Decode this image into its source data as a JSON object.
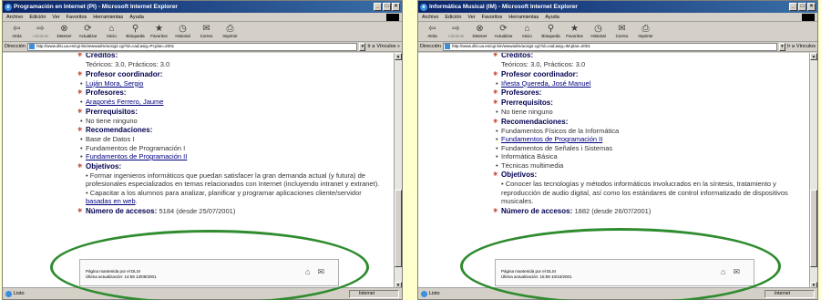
{
  "windows": [
    {
      "title": "Programación en Internet (PI) - Microsoft Internet Explorer",
      "window_buttons": [
        "_",
        "□",
        "×"
      ],
      "menu": [
        "Archivo",
        "Edición",
        "Ver",
        "Favoritos",
        "Herramientas",
        "Ayuda"
      ],
      "toolbar": [
        {
          "icon": "back-arrow-icon",
          "glyph": "⇦",
          "label": "Atrás",
          "enabled": true
        },
        {
          "icon": "forward-arrow-icon",
          "glyph": "⇨",
          "label": "Adelante",
          "enabled": false
        },
        {
          "icon": "stop-icon",
          "glyph": "⊗",
          "label": "Detener",
          "enabled": true
        },
        {
          "icon": "refresh-icon",
          "glyph": "⟳",
          "label": "Actualizar",
          "enabled": true
        },
        {
          "icon": "home-icon",
          "glyph": "⌂",
          "label": "Inicio",
          "enabled": true
        },
        {
          "icon": "search-icon",
          "glyph": "⚲",
          "label": "Búsqueda",
          "enabled": true
        },
        {
          "icon": "favorites-icon",
          "glyph": "★",
          "label": "Favoritos",
          "enabled": true
        },
        {
          "icon": "history-icon",
          "glyph": "◷",
          "label": "Historial",
          "enabled": true
        },
        {
          "icon": "mail-icon",
          "glyph": "✉",
          "label": "Correo",
          "enabled": true
        },
        {
          "icon": "print-icon",
          "glyph": "⎙",
          "label": "Imprimir",
          "enabled": true
        }
      ],
      "address_label": "Dirección",
      "address_value": "http://www.dlsi.ua.es/cgi-bin/wwwadm/acsig2.cgi?id=cad;asig=PI;plan=2001",
      "go_label": "Ir a",
      "links_label": "Vínculos »",
      "sections": [
        {
          "heading": "Créditos:",
          "items": [
            {
              "text": "Teóricos: 3.0, Prácticos: 3.0",
              "bullet": false,
              "link": false
            }
          ]
        },
        {
          "heading": "Profesor coordinador:",
          "items": [
            {
              "text": "Luján Mora, Sergio",
              "bullet": true,
              "link": true
            }
          ]
        },
        {
          "heading": "Profesores:",
          "items": [
            {
              "text": "Aragonés Ferrero, Jaume",
              "bullet": true,
              "link": true
            }
          ]
        },
        {
          "heading": "Prerrequisitos:",
          "items": [
            {
              "text": "No tiene ninguno",
              "bullet": true,
              "link": false
            }
          ]
        },
        {
          "heading": "Recomendaciones:",
          "items": [
            {
              "text": "Base de Datos I",
              "bullet": true,
              "link": false
            },
            {
              "text": "Fundamentos de Programación I",
              "bullet": true,
              "link": false
            },
            {
              "text": "Fundamentos de Programación II",
              "bullet": true,
              "link": true
            }
          ]
        },
        {
          "heading": "Objetivos:",
          "paragraphs": [
            {
              "text": "• Formar ingenieros informáticos que puedan satisfacer la gran demanda actual (y futura) de profesionales especializados en temas relacionados con Internet (incluyendo intranet y extranet)."
            },
            {
              "text": "• Capacitar a los alumnos para analizar, planificar y programar aplicaciones cliente/servidor ",
              "link_text": "basadas en web",
              "suffix": "."
            }
          ]
        },
        {
          "heading": "Número de accesos:",
          "inline_value": "5184 (desde 25/07/2001)"
        }
      ],
      "footer": {
        "line1": "Página mantenida por el DLSI",
        "line2": "Última actualización: 14:59 13/09/2001"
      },
      "status_text": "Listo",
      "zone": "Internet"
    },
    {
      "title": "Informática Musical (IM) - Microsoft Internet Explorer",
      "window_buttons": [
        "_",
        "□",
        "×"
      ],
      "menu": [
        "Archivo",
        "Edición",
        "Ver",
        "Favoritos",
        "Herramientas",
        "Ayuda"
      ],
      "toolbar": [
        {
          "icon": "back-arrow-icon",
          "glyph": "⇦",
          "label": "Atrás",
          "enabled": true
        },
        {
          "icon": "forward-arrow-icon",
          "glyph": "⇨",
          "label": "Adelante",
          "enabled": false
        },
        {
          "icon": "stop-icon",
          "glyph": "⊗",
          "label": "Detener",
          "enabled": true
        },
        {
          "icon": "refresh-icon",
          "glyph": "⟳",
          "label": "Actualizar",
          "enabled": true
        },
        {
          "icon": "home-icon",
          "glyph": "⌂",
          "label": "Inicio",
          "enabled": true
        },
        {
          "icon": "search-icon",
          "glyph": "⚲",
          "label": "Búsqueda",
          "enabled": true
        },
        {
          "icon": "favorites-icon",
          "glyph": "★",
          "label": "Favoritos",
          "enabled": true
        },
        {
          "icon": "history-icon",
          "glyph": "◷",
          "label": "Historial",
          "enabled": true
        },
        {
          "icon": "mail-icon",
          "glyph": "✉",
          "label": "Correo",
          "enabled": true
        },
        {
          "icon": "print-icon",
          "glyph": "⎙",
          "label": "Imprimir",
          "enabled": true
        }
      ],
      "address_label": "Dirección",
      "address_value": "http://www.dlsi.ua.es/cgi-bin/wwwadm/acsig2.cgi?id=cad;asig=IM;plan=2001",
      "go_label": "Ir a",
      "links_label": "Vínculos",
      "sections": [
        {
          "heading": "Créditos:",
          "items": [
            {
              "text": "Teóricos: 3.0, Prácticos: 3.0",
              "bullet": false,
              "link": false
            }
          ]
        },
        {
          "heading": "Profesor coordinador:",
          "items": [
            {
              "text": "Iñesta Quereda, José Manuel",
              "bullet": true,
              "link": true
            }
          ]
        },
        {
          "heading": "Profesores:",
          "items": []
        },
        {
          "heading": "Prerrequisitos:",
          "items": [
            {
              "text": "No tiene ninguno",
              "bullet": true,
              "link": false
            }
          ]
        },
        {
          "heading": "Recomendaciones:",
          "items": [
            {
              "text": "Fundamentos Físicos de la Informática",
              "bullet": true,
              "link": false
            },
            {
              "text": "Fundamentos de Programación II",
              "bullet": true,
              "link": true
            },
            {
              "text": "Fundamentos de Señales i Sistemas",
              "bullet": true,
              "link": false
            },
            {
              "text": "Informática Básica",
              "bullet": true,
              "link": false
            },
            {
              "text": "Técnicas multimedia",
              "bullet": true,
              "link": false
            }
          ]
        },
        {
          "heading": "Objetivos:",
          "paragraphs": [
            {
              "text": "• Conocer las tecnologías y métodos informáticos involucrados en la síntesis, tratamiento y reproducción de audio digital, así como los estándares de control informatizado de dispositivos musicales."
            }
          ]
        },
        {
          "heading": "Número de accesos:",
          "inline_value": "1882 (desde 26/07/2001)"
        }
      ],
      "footer": {
        "line1": "Página mantenida por el DLSI",
        "line2": "Última actualización: 15:59 10/10/2001"
      },
      "status_text": "Listo",
      "zone": "Internet"
    }
  ],
  "colors": {
    "highlight_ellipse": "#2e8b2e",
    "background": "#ffffcc",
    "title_bar": "#0a246a"
  }
}
